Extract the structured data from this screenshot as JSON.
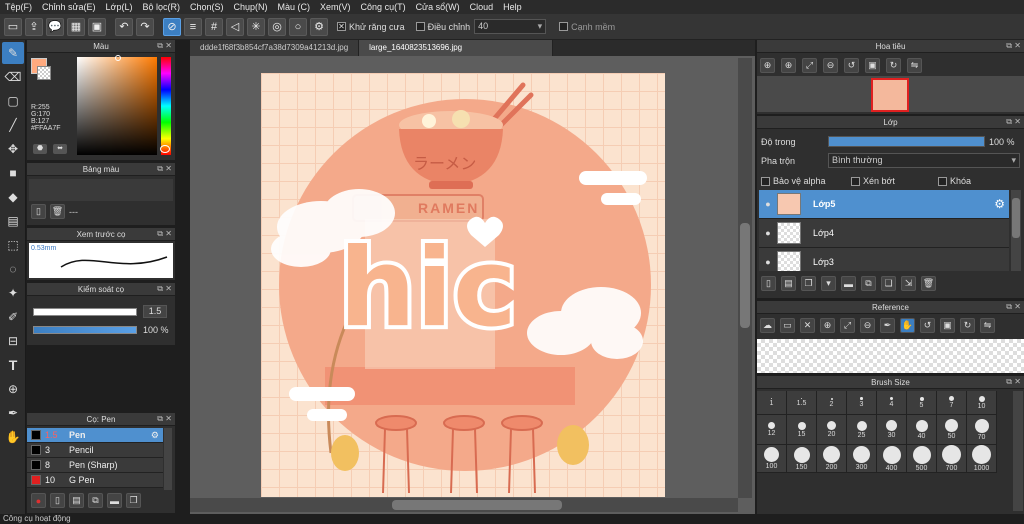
{
  "menu": [
    "Tệp(F)",
    "Chỉnh sửa(E)",
    "Lớp(L)",
    "Bộ lọc(R)",
    "Chọn(S)",
    "Chụp(N)",
    "Màu (C)",
    "Xem(V)",
    "Công cụ(T)",
    "Cửa sổ(W)",
    "Cloud",
    "Help"
  ],
  "toolbar": {
    "antialias_label": "Khử răng cưa",
    "adjust_label": "Điều chỉnh",
    "adjust_value": "40",
    "smooth_label": "Cạnh mềm"
  },
  "color_panel": {
    "title": "Màu",
    "r": "R:255",
    "g": "G:170",
    "b": "B:127",
    "hex": "#FFAA7F",
    "primary": "#ffaa7f"
  },
  "palette_panel": {
    "title": "Bảng màu",
    "empty": "---"
  },
  "brush_preview": {
    "title": "Xem trước cọ",
    "size": "0.53mm"
  },
  "brush_control": {
    "title": "Kiểm soát cọ",
    "size_value": "1.5",
    "opacity_value": "100 %"
  },
  "brush_list": {
    "title": "Cọ: Pen",
    "items": [
      {
        "size": "1.5",
        "name": "Pen",
        "color": "#000000"
      },
      {
        "size": "3",
        "name": "Pencil",
        "color": "#000000"
      },
      {
        "size": "8",
        "name": "Pen (Sharp)",
        "color": "#000000"
      },
      {
        "size": "10",
        "name": "G Pen",
        "color": "#e02020"
      }
    ]
  },
  "tabs": [
    "ddde1f68f3b854cf7a38d7309a41213d.jpg",
    "large_1640823513696.jpg"
  ],
  "artwork": {
    "main_text": "hic",
    "sub_text": "ラーメン",
    "sign_text": "RAMEN"
  },
  "navigator": {
    "title": "Hoa tiêu"
  },
  "layer_panel": {
    "title": "Lớp",
    "opacity_label": "Độ trong",
    "opacity_value": "100 %",
    "opacity_fraction": 1.0,
    "blend_label": "Pha trộn",
    "blend_value": "Bình thường",
    "protect_alpha": "Bảo vệ alpha",
    "clipping": "Xén bớt",
    "lock": "Khóa",
    "layers": [
      "Lớp5",
      "Lớp4",
      "Lớp3"
    ]
  },
  "reference": {
    "title": "Reference"
  },
  "brush_size": {
    "title": "Brush Size",
    "sizes": [
      "1",
      "1.5",
      "2",
      "3",
      "4",
      "5",
      "7",
      "10",
      "12",
      "15",
      "20",
      "25",
      "30",
      "40",
      "50",
      "70",
      "100",
      "150",
      "200",
      "300",
      "400",
      "500",
      "700",
      "1000"
    ]
  },
  "status": "Công cụ hoạt động"
}
